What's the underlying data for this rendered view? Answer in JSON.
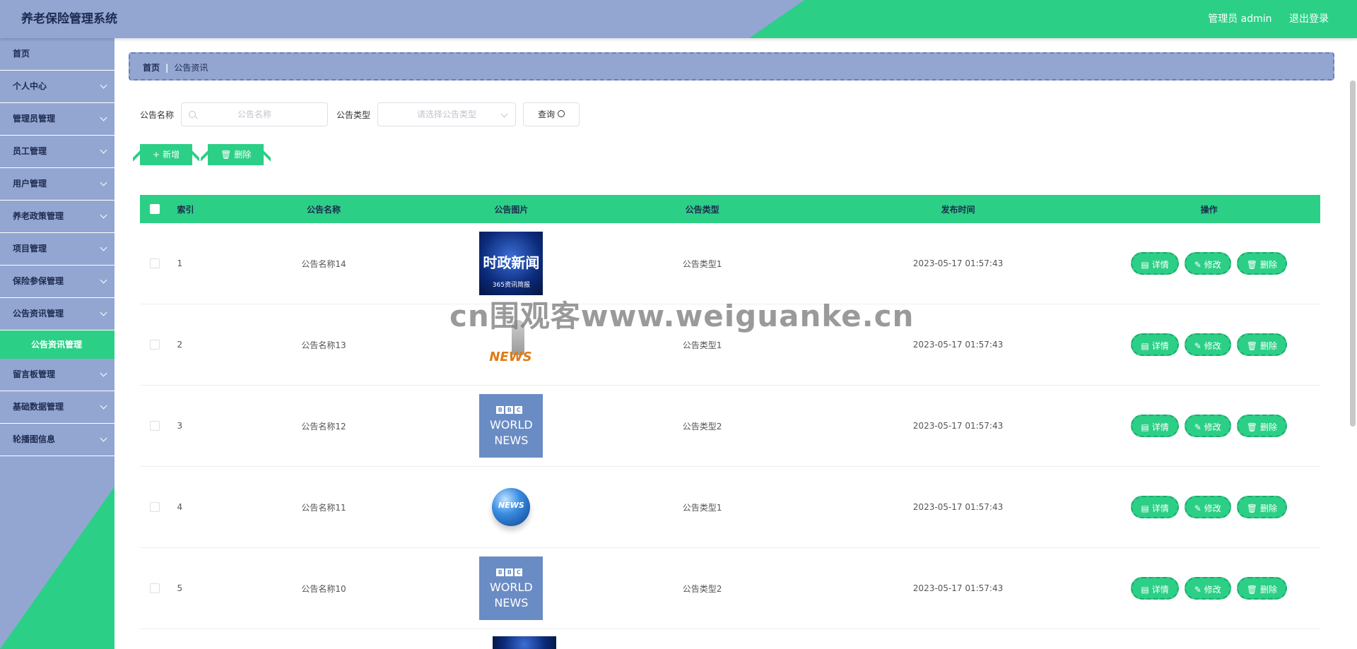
{
  "header": {
    "title": "养老保险管理系统",
    "user": "管理员 admin",
    "logout": "退出登录"
  },
  "sidebar": {
    "items": [
      {
        "label": "首页"
      },
      {
        "label": "个人中心"
      },
      {
        "label": "管理员管理"
      },
      {
        "label": "员工管理"
      },
      {
        "label": "用户管理"
      },
      {
        "label": "养老政策管理"
      },
      {
        "label": "项目管理"
      },
      {
        "label": "保险参保管理"
      },
      {
        "label": "公告资讯管理"
      },
      {
        "label": "公告资讯管理"
      },
      {
        "label": "留言板管理"
      },
      {
        "label": "基础数据管理"
      },
      {
        "label": "轮播图信息"
      }
    ]
  },
  "breadcrumb": {
    "home": "首页",
    "sep": "|",
    "current": "公告资讯"
  },
  "search": {
    "name_label": "公告名称",
    "name_placeholder": "公告名称",
    "type_label": "公告类型",
    "type_placeholder": "请选择公告类型",
    "query": "查询"
  },
  "actions": {
    "add": "新增",
    "delete": "删除"
  },
  "table": {
    "headers": [
      "索引",
      "公告名称",
      "公告图片",
      "公告类型",
      "发布时间",
      "操作"
    ],
    "ops": {
      "detail": "详情",
      "edit": "修改",
      "delete": "删除"
    },
    "rows": [
      {
        "index": "1",
        "name": "公告名称14",
        "image": "news-broadcast",
        "image_text": "时政新闻",
        "image_sub": "365资讯简报",
        "type": "公告类型1",
        "time": "2023-05-17 01:57:43"
      },
      {
        "index": "2",
        "name": "公告名称13",
        "image": "news-3d-figure",
        "image_text": "NEWS",
        "type": "公告类型1",
        "time": "2023-05-17 01:57:43"
      },
      {
        "index": "3",
        "name": "公告名称12",
        "image": "bbc-world-news",
        "image_text": "WORLD",
        "image_sub": "NEWS",
        "type": "公告类型2",
        "time": "2023-05-17 01:57:43"
      },
      {
        "index": "4",
        "name": "公告名称11",
        "image": "news-globe",
        "image_text": "NEWS",
        "type": "公告类型1",
        "time": "2023-05-17 01:57:43"
      },
      {
        "index": "5",
        "name": "公告名称10",
        "image": "bbc-world-news",
        "image_text": "WORLD",
        "image_sub": "NEWS",
        "type": "公告类型2",
        "time": "2023-05-17 01:57:43"
      }
    ]
  },
  "watermark": "cn围观客www.weiguanke.cn",
  "colors": {
    "accent": "#2ccf86",
    "nav": "#93a6d2",
    "title": "#1d2b4f"
  }
}
